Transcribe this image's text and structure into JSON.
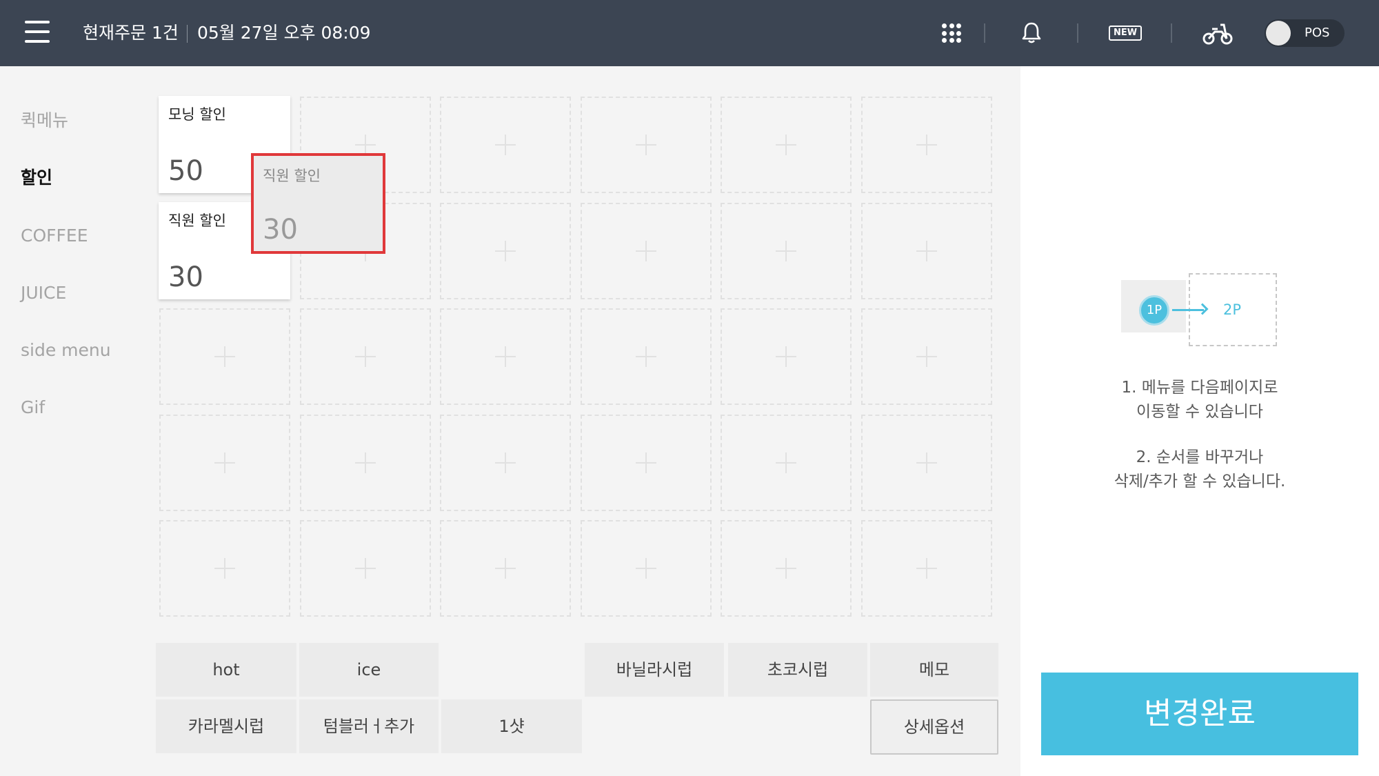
{
  "header": {
    "order_status": "현재주문 1건",
    "datetime": "05월 27일 오후 08:09",
    "new_badge": "NEW",
    "pos_label": "POS"
  },
  "categories": [
    {
      "label": "퀵메뉴",
      "active": false
    },
    {
      "label": "할인",
      "active": true
    },
    {
      "label": "COFFEE",
      "active": false
    },
    {
      "label": "JUICE",
      "active": false
    },
    {
      "label": "side menu",
      "active": false
    },
    {
      "label": "Gif",
      "active": false
    }
  ],
  "grid": {
    "rows": 5,
    "cols": 6,
    "tiles": [
      {
        "row": 0,
        "col": 0,
        "name": "모닝 할인",
        "value": "50"
      },
      {
        "row": 1,
        "col": 0,
        "name": "직원 할인",
        "value": "30"
      }
    ],
    "dragging": {
      "name": "직원 할인",
      "value": "30"
    }
  },
  "options": {
    "hot": "hot",
    "ice": "ice",
    "vanilla": "바닐라시럽",
    "choco": "초코시럽",
    "memo": "메모",
    "caramel": "카라멜시럽",
    "tumbler": "텀블러ㅓ추가",
    "shot": "1샷",
    "detail": "상세옵션"
  },
  "info": {
    "page1": "1P",
    "page2": "2P",
    "line1": "1. 메뉴를 다음페이지로",
    "line2": "이동할 수 있습니다",
    "line3": "2. 순서를 바꾸거나",
    "line4": "삭제/추가 할 수 있습니다."
  },
  "done_button": "변경완료",
  "colors": {
    "header_bg": "#3c4553",
    "accent": "#47bfe0",
    "drag_border": "#e0383a"
  }
}
